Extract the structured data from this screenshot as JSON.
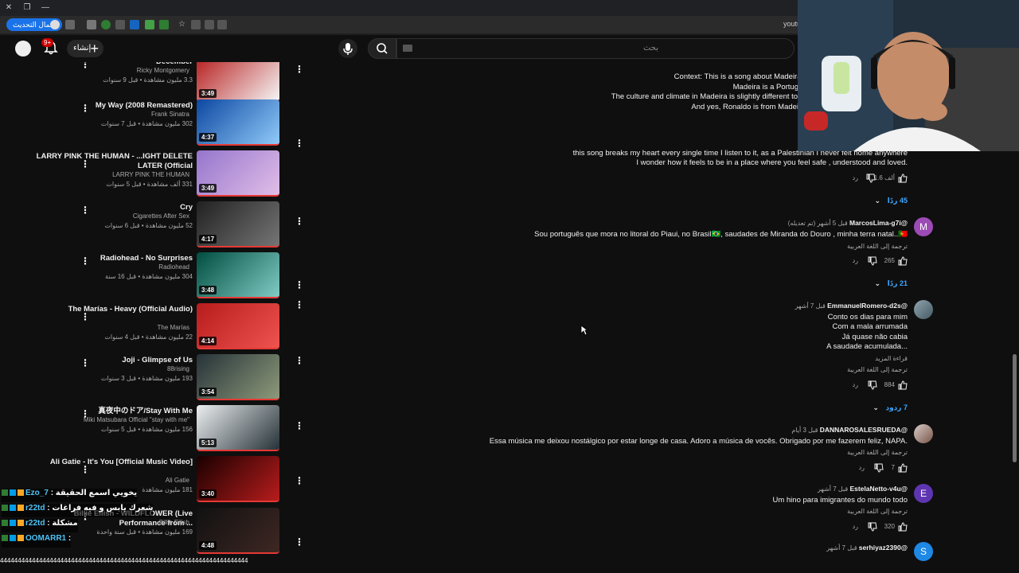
{
  "browser": {
    "update_label": "إكمال التحديث",
    "url_host": "youtu"
  },
  "topbar": {
    "create_label": "إنشاء",
    "notification_count": "9+",
    "search_placeholder": "بحث"
  },
  "playlist": [
    {
      "title": "December",
      "channel": "Ricky Montgomery",
      "meta": "3.3 مليون مشاهدة • قبل 9 سنوات",
      "duration": "3:49"
    },
    {
      "title": "My Way (2008 Remastered)",
      "channel": "Frank Sinatra",
      "meta": "302 مليون مشاهدة • قبل 7 سنوات",
      "duration": "4:37"
    },
    {
      "title": "LARRY PINK THE HUMAN - ...IGHT DELETE LATER (Official",
      "channel": "LARRY PINK THE HUMAN",
      "meta": "331 ألف مشاهدة • قبل 5 سنوات",
      "duration": "3:49"
    },
    {
      "title": "Cry",
      "channel": "Cigarettes After Sex",
      "meta": "52 مليون مشاهدة • قبل 6 سنوات",
      "duration": "4:17"
    },
    {
      "title": "Radiohead - No Surprises",
      "channel": "Radiohead",
      "meta": "304 مليون مشاهدة • قبل 16 سنة",
      "duration": "3:48"
    },
    {
      "title": "The Marías - Heavy (Official Audio)",
      "channel": "The Marías",
      "meta": "22 مليون مشاهدة • قبل 4 سنوات",
      "duration": "4:14"
    },
    {
      "title": "Joji - Glimpse of Us",
      "channel": "88rising",
      "meta": "193 مليون مشاهدة • قبل 3 سنوات",
      "duration": "3:54"
    },
    {
      "title": "真夜中のドア/Stay With Me",
      "channel": "Miki Matsubara Official \"stay with me\"",
      "meta": "156 مليون مشاهدة • قبل 5 سنوات",
      "duration": "5:13"
    },
    {
      "title": "Ali Gatie - It's You [Official Music Video]",
      "channel": "Ali Gatie",
      "meta": "181 مليون مشاهدة",
      "duration": "3:40"
    },
    {
      "title": "Billie Eilish - WILDFLOWER (Live Performance from ...",
      "channel": "Billie Eilish",
      "meta": "169 مليون مشاهدة • قبل سنة واحدة",
      "duration": "4:48"
    }
  ],
  "chat": [
    {
      "user": "Ezo_7",
      "msg": ": يخويي اسمع الحقيقة"
    },
    {
      "user": "r22td",
      "msg": ": شعرك يابس و فيه فراغات"
    },
    {
      "user": "r22td",
      "msg": ": مشكلة"
    },
    {
      "user": "OOMARR1",
      "msg": ":"
    }
  ],
  "bottom_strip": "4444444444444444444444444444444444444444444444444444444444444444444444",
  "comments": {
    "context": [
      "Context: This is a song about Madeiran's who have immigrated for a better life but w",
      "Madeira is a Portuguese island in the Atlantic ocean and is located",
      "The culture and climate in Madeira is slightly different to \"continental\" Portugal and even those Madeira",
      "And yes, Ronaldo is from Madeira island, the airport was even renamed to Cris"
    ],
    "c1": {
      "text": [
        "this song breaks my heart every single time I listen to it, as a Palestinian I never felt home anywhere",
        "I wonder how it feels to be in a place where you feel safe , understood and loved."
      ],
      "likes": "1.6 ألف",
      "reply": "رد",
      "replies": "45 ردًا"
    },
    "c2": {
      "user": "@MarcosLima-g7i",
      "time": "قبل 5 أشهر (تم تعديله)",
      "avatar": "M",
      "avatar_color": "#9c4bb4",
      "text": "Sou português que mora no litoral do Piaui, no Brasil🇧🇷, saudades de Miranda do Douro , minha terra natal..🇵🇹",
      "translate": "ترجمة إلى اللغة العربية",
      "likes": "265",
      "reply": "رد",
      "replies": "21 ردًا"
    },
    "c3": {
      "user": "@EmmanuelRomero-d2s",
      "time": "قبل 7 أشهر",
      "lines": [
        "Conto os dias para mim",
        "Com a mala arrumada",
        "Já quase não cabia",
        "A saudade acumulada..."
      ],
      "read_more": "قراءة المزيد",
      "translate": "ترجمة إلى اللغة العربية",
      "likes": "884",
      "reply": "رد",
      "replies": "7 ردود"
    },
    "c4": {
      "user": "@DANNAROSALESRUEDA",
      "time": "قبل 3 أيام",
      "text": "Essa música me deixou nostálgico por estar longe de casa. Adoro a música de vocês. Obrigado por me fazerem feliz, NAPA.",
      "translate": "ترجمة إلى اللغة العربية",
      "likes": "7",
      "reply": "رد"
    },
    "c5": {
      "user": "@EstelaNetto-v4u",
      "time": "قبل 7 أشهر",
      "avatar": "E",
      "avatar_color": "#5e35b1",
      "text": "Um hino para imigrantes do mundo todo",
      "translate": "ترجمة إلى اللغة العربية",
      "likes": "320",
      "reply": "رد"
    },
    "c6": {
      "user": "@serhiyaz2390",
      "time": "قبل 7 أشهر",
      "avatar": "S",
      "avatar_color": "#1e88e5"
    }
  }
}
